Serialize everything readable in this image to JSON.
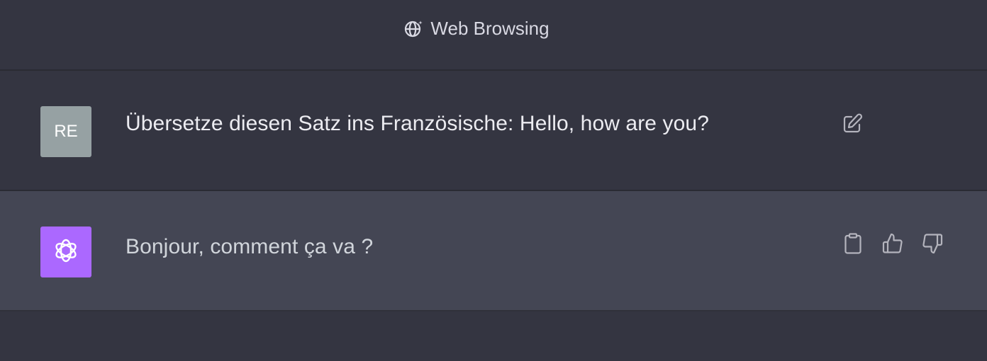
{
  "header": {
    "title": "Web Browsing",
    "icon": "globe-sparkle-icon"
  },
  "conversation": {
    "user_message": {
      "avatar_initials": "RE",
      "text": "Übersetze diesen Satz ins Französische: Hello, how are you?",
      "actions": [
        "edit-icon"
      ]
    },
    "assistant_message": {
      "avatar_icon": "openai-logo-icon",
      "text": "Bonjour, comment ça va ?",
      "actions": [
        "clipboard-icon",
        "thumbs-up-icon",
        "thumbs-down-icon"
      ]
    }
  },
  "colors": {
    "background": "#343541",
    "assistant_row": "#444654",
    "user_avatar": "#96a1a3",
    "assistant_avatar": "#ab68ff",
    "text": "#ececf1"
  }
}
